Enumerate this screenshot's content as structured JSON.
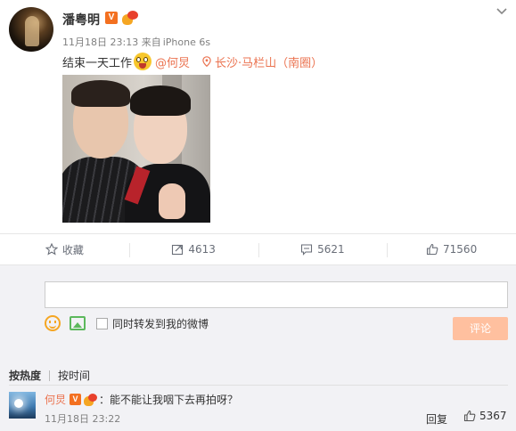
{
  "post": {
    "username": "潘粤明",
    "verified_badge": "V",
    "timestamp": "11月18日 23:13",
    "source_prefix": "来自",
    "source": "iPhone 6s",
    "text": "结束一天工作",
    "mention": "@何炅",
    "location": "长沙·马栏山（南圈）",
    "icons": [
      "avatar",
      "verified-badge",
      "medal-icon",
      "chevron-down-icon",
      "emoji-surprised-icon",
      "location-pin-icon"
    ]
  },
  "actions": {
    "favorite_label": "收藏",
    "repost_count": "4613",
    "comment_count": "5621",
    "like_count": "71560"
  },
  "composer": {
    "input_value": "",
    "repost_checkbox_label": "同时转发到我的微博",
    "submit_label": "评论"
  },
  "comments": {
    "sort_hot": "按热度",
    "sort_time": "按时间",
    "items": [
      {
        "name": "何炅",
        "badge": "V",
        "text": "：能不能让我咽下去再拍呀？",
        "time": "11月18日 23:22",
        "reply_label": "回复",
        "likes": "5367"
      }
    ]
  },
  "colors": {
    "accent": "#eb7350",
    "badge": "#f37020",
    "submit_disabled": "#ffc09f",
    "panel_bg": "#f2f2f5"
  }
}
